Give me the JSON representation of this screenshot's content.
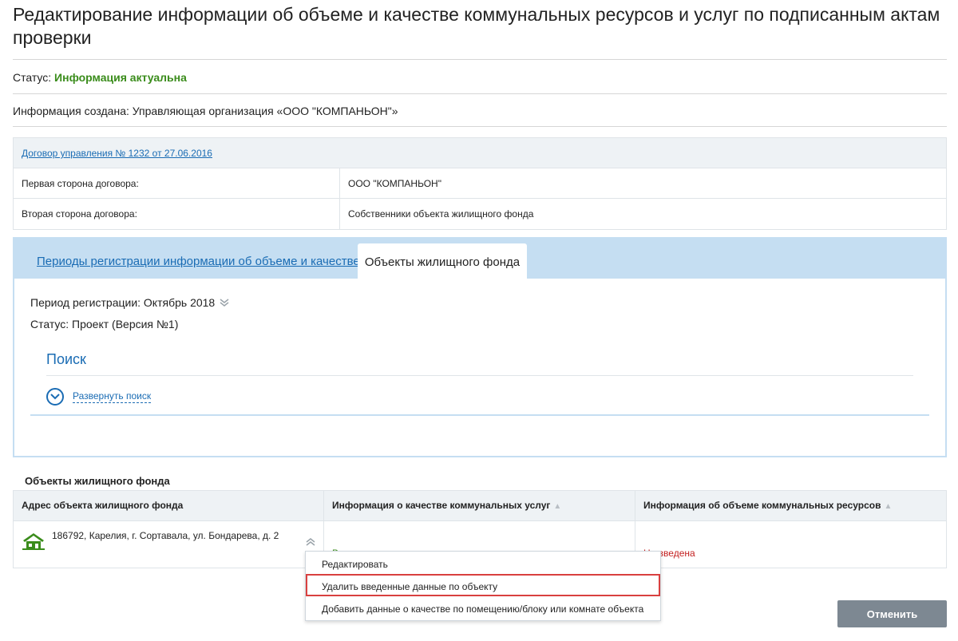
{
  "page": {
    "title": "Редактирование информации об объеме и качестве коммунальных ресурсов и услуг по подписанным актам проверки"
  },
  "status": {
    "label": "Статус:",
    "value": "Информация актуальна"
  },
  "created": {
    "text": "Информация создана: Управляющая организация «ООО \"КОМПАНЬОН\"»"
  },
  "contract": {
    "link": "Договор управления № 1232 от 27.06.2016",
    "rows": [
      {
        "label": "Первая сторона договора:",
        "value": "ООО \"КОМПАНЬОН\""
      },
      {
        "label": "Вторая сторона договора:",
        "value": "Собственники объекта жилищного фонда"
      }
    ]
  },
  "tabs": [
    {
      "label": "Периоды регистрации информации об объеме и качестве",
      "active": false
    },
    {
      "label": "Объекты жилищного фонда",
      "active": true
    }
  ],
  "period": {
    "text": "Период регистрации: Октябрь 2018",
    "status": "Статус: Проект (Версия №1)"
  },
  "search": {
    "title": "Поиск",
    "expand_label": "Развернуть поиск"
  },
  "objects": {
    "title": "Объекты жилищного фонда",
    "columns": [
      "Адрес объекта жилищного фонда",
      "Информация о качестве коммунальных услуг",
      "Информация об объеме коммунальных ресурсов"
    ],
    "rows": [
      {
        "address": "186792, Карелия, г. Сортавала, ул. Бондарева, д. 2",
        "quality": "Введена",
        "volume": "Не введена"
      }
    ]
  },
  "context_menu": {
    "items": [
      "Редактировать",
      "Удалить введенные данные по объекту",
      "Добавить данные о качестве по помещению/блоку или комнате объекта"
    ],
    "highlighted_index": 1
  },
  "buttons": {
    "cancel": "Отменить"
  },
  "colors": {
    "accent": "#1a6cb4",
    "success": "#3a8c1b",
    "danger": "#c31f1f",
    "highlight_border": "#d9403f",
    "tab_bar": "#c5def2",
    "cancel_button": "#7d8892"
  },
  "icons": {
    "house": "house-icon",
    "expand": "chevron-down-circle-icon",
    "period_toggle": "double-chevron-down-icon",
    "row_menu": "double-chevron-up-icon",
    "sort": "sort-up-icon"
  }
}
